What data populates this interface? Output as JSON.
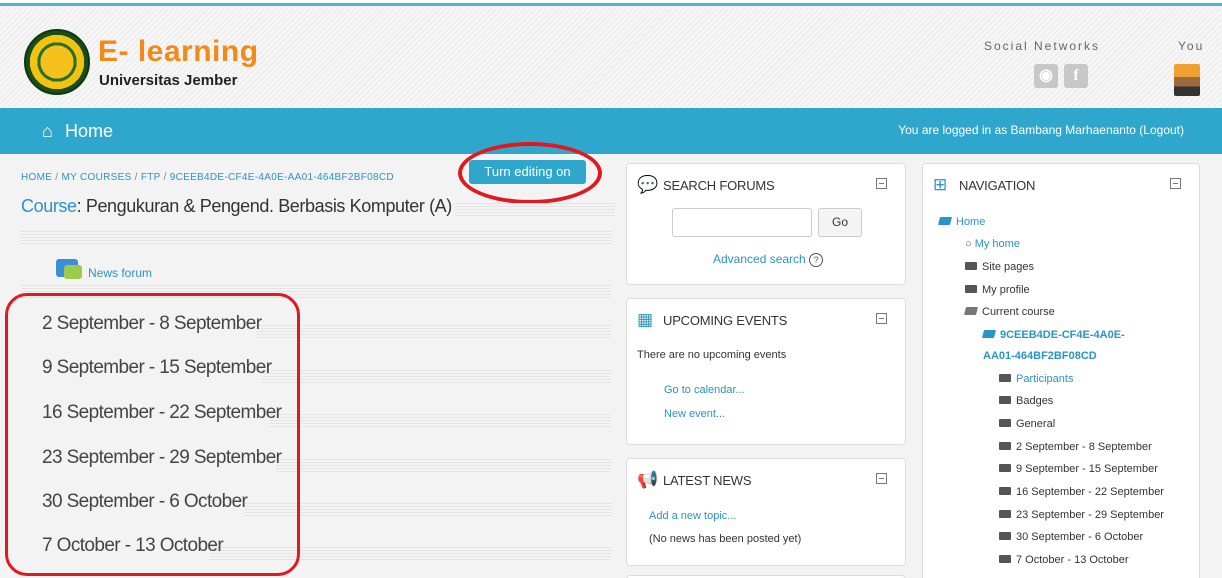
{
  "header": {
    "logo_title": "E- learning",
    "logo_subtitle": "Universitas Jember",
    "social_label": "Social Networks",
    "you_label": "You",
    "social_icons": [
      "globe-icon",
      "facebook-icon"
    ]
  },
  "navbar": {
    "home_label": "Home",
    "login_text": "You are logged in as Bambang Marhaenanto (Logout)"
  },
  "breadcrumb": {
    "items": [
      "HOME",
      "MY COURSES",
      "FTP",
      "9CEEB4DE-CF4E-4A0E-AA01-464BF2BF08CD"
    ],
    "separator": "/"
  },
  "toolbar": {
    "edit_button": "Turn editing on"
  },
  "course": {
    "label": "Course",
    "title": ": Pengukuran & Pengend. Berbasis Komputer (A)",
    "news_forum": "News forum",
    "sections": [
      "2 September - 8 September",
      "9 September - 15 September",
      "16 September - 22 September",
      "23 September - 29 September",
      "30 September - 6 October",
      "7 October - 13 October"
    ]
  },
  "search_forums": {
    "title": "SEARCH FORUMS",
    "go_label": "Go",
    "advanced_label": "Advanced search"
  },
  "upcoming_events": {
    "title": "UPCOMING EVENTS",
    "empty_text": "There are no upcoming events",
    "calendar_link": "Go to calendar...",
    "new_event_link": "New event..."
  },
  "latest_news": {
    "title": "LATEST NEWS",
    "add_topic": "Add a new topic...",
    "empty_text": "(No news has been posted yet)"
  },
  "navigation": {
    "title": "NAVIGATION",
    "home": "Home",
    "my_home": "My home",
    "site_pages": "Site pages",
    "my_profile": "My profile",
    "current_course": "Current course",
    "course_id_line1": "9CEEB4DE-CF4E-4A0E-",
    "course_id_line2": "AA01-464BF2BF08CD",
    "participants": "Participants",
    "badges": "Badges",
    "general": "General",
    "weeks": [
      "2 September - 8 September",
      "9 September - 15 September",
      "16 September - 22 September",
      "23 September - 29 September",
      "30 September - 6 October",
      "7 October - 13 October"
    ]
  },
  "colors": {
    "accent": "#2fa7cc",
    "brand_orange": "#f28a1a",
    "highlight_red": "#e0191f"
  }
}
